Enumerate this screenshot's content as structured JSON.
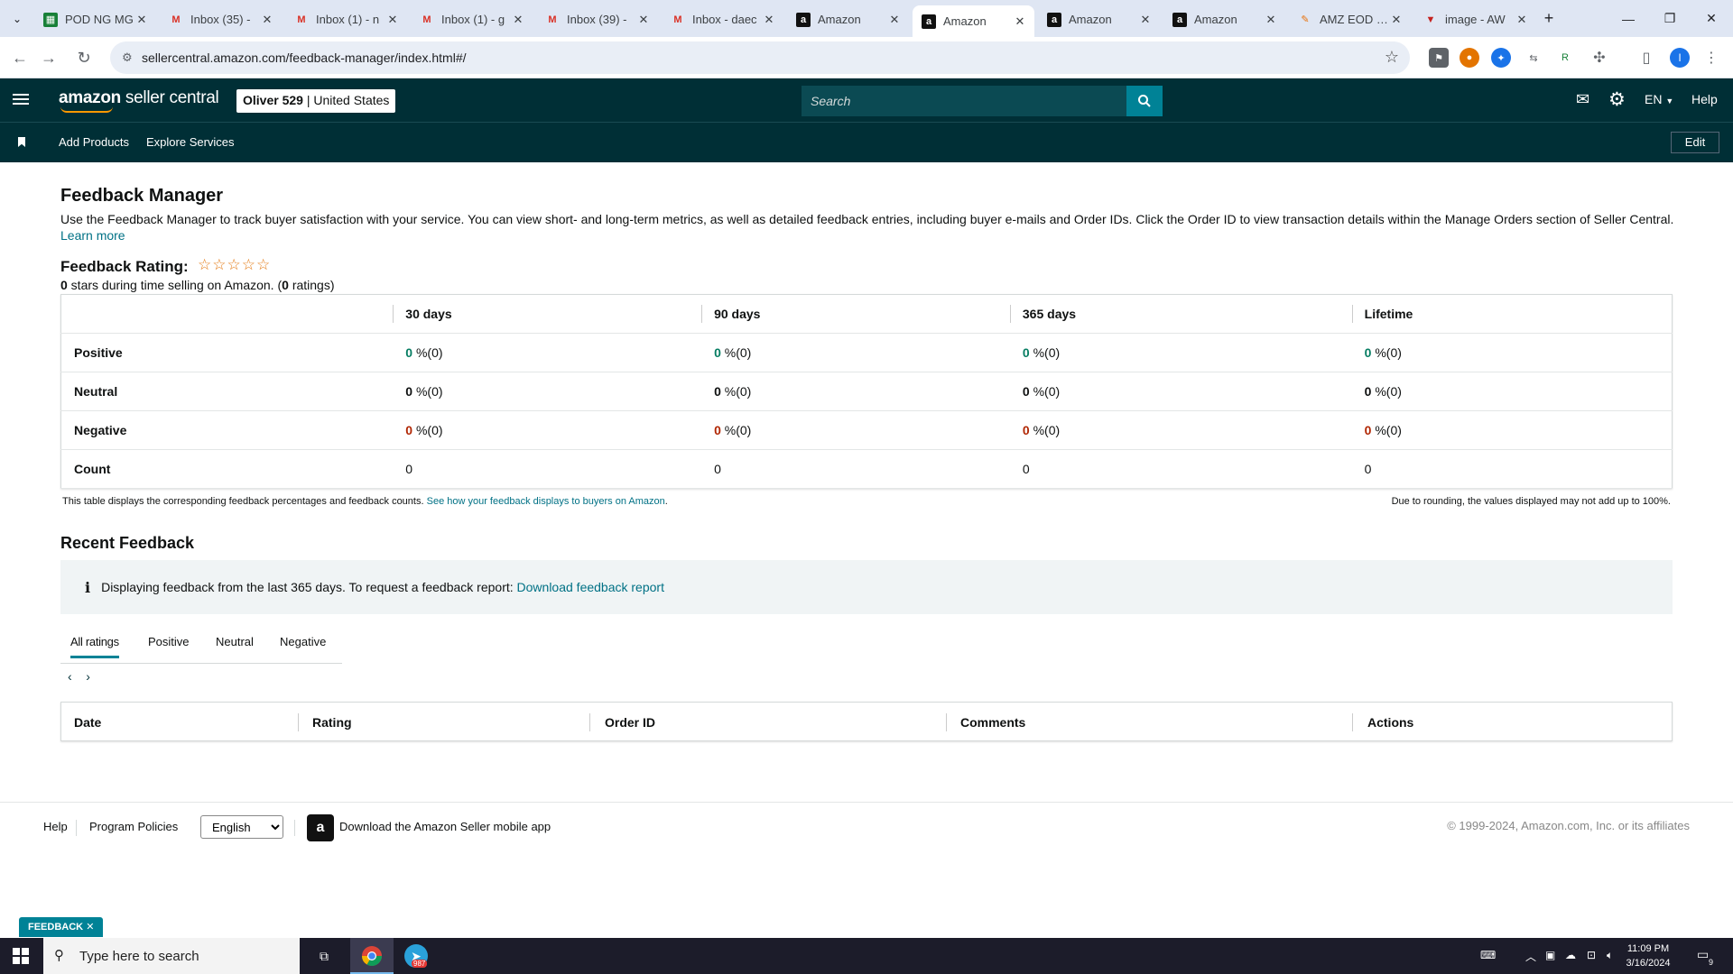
{
  "browser": {
    "tabs": [
      {
        "title": "POD NG MG",
        "icon": "sheets-icon"
      },
      {
        "title": "Inbox (35) - ",
        "icon": "gmail-icon"
      },
      {
        "title": "Inbox (1) - n",
        "icon": "gmail-icon"
      },
      {
        "title": "Inbox (1) - g",
        "icon": "gmail-icon"
      },
      {
        "title": "Inbox (39) - ",
        "icon": "gmail-icon"
      },
      {
        "title": "Inbox - daec",
        "icon": "gmail-icon"
      },
      {
        "title": "Amazon",
        "icon": "amazon-icon"
      },
      {
        "title": "Amazon",
        "icon": "amazon-icon"
      },
      {
        "title": "Amazon",
        "icon": "amazon-icon"
      },
      {
        "title": "Amazon",
        "icon": "amazon-icon"
      },
      {
        "title": "AMZ EOD Re",
        "icon": "eod-icon"
      },
      {
        "title": "image - AW",
        "icon": "image-icon"
      }
    ],
    "url": "sellercentral.amazon.com/feedback-manager/index.html#/",
    "profile_initial": "I"
  },
  "header": {
    "logo_bold": "amazon",
    "logo_rest": " seller central",
    "account_name": "Oliver 529",
    "account_region": "United States",
    "search_placeholder": "Search",
    "language": "EN",
    "help": "Help",
    "sub_links": [
      "Add Products",
      "Explore Services"
    ],
    "edit_label": "Edit"
  },
  "page": {
    "title": "Feedback Manager",
    "intro": "Use the Feedback Manager to track buyer satisfaction with your service. You can view short- and long-term metrics, as well as detailed feedback entries, including buyer e-mails and Order IDs. Click the Order ID to view transaction details within the Manage Orders section of Seller Central.",
    "learn_more": "Learn more",
    "rating_label": "Feedback Rating:",
    "stars": "☆☆☆☆☆",
    "rating_stars_count": "0",
    "rating_sub_mid": " stars during time selling on Amazon. (",
    "rating_count": "0",
    "rating_sub_end": " ratings)",
    "table": {
      "columns": [
        "30 days",
        "90 days",
        "365 days",
        "Lifetime"
      ],
      "rows": [
        {
          "label": "Positive",
          "values": [
            "0",
            "0",
            "0",
            "0"
          ],
          "suffix": " %(0)"
        },
        {
          "label": "Neutral",
          "values": [
            "0",
            "0",
            "0",
            "0"
          ],
          "suffix": " %(0)"
        },
        {
          "label": "Negative",
          "values": [
            "0",
            "0",
            "0",
            "0"
          ],
          "suffix": " %(0)"
        },
        {
          "label": "Count",
          "values": [
            "0",
            "0",
            "0",
            "0"
          ],
          "suffix": ""
        }
      ]
    },
    "table_note": "This table displays the corresponding feedback percentages and feedback counts.",
    "table_note_link": "See how your feedback displays to buyers on Amazon",
    "table_note_end": ".",
    "rounding_note": "Due to rounding, the values displayed may not add up to 100%.",
    "recent_title": "Recent Feedback",
    "info_text": "Displaying feedback from the last 365 days. To request a feedback report:",
    "info_link": "Download feedback report",
    "filter_tabs": [
      "All ratings",
      "Positive",
      "Neutral",
      "Negative"
    ],
    "recent_columns": [
      "Date",
      "Rating",
      "Order ID",
      "Comments",
      "Actions"
    ]
  },
  "footer": {
    "help": "Help",
    "policies": "Program Policies",
    "language_selected": "English",
    "app_text": "Download the Amazon Seller mobile app",
    "copyright": "© 1999-2024, Amazon.com, Inc. or its affiliates",
    "feedback_tab": "FEEDBACK"
  },
  "taskbar": {
    "search_placeholder": "Type here to search",
    "time": "11:09 PM",
    "date": "3/16/2024",
    "telegram_badge": "987",
    "notifications": "9"
  }
}
